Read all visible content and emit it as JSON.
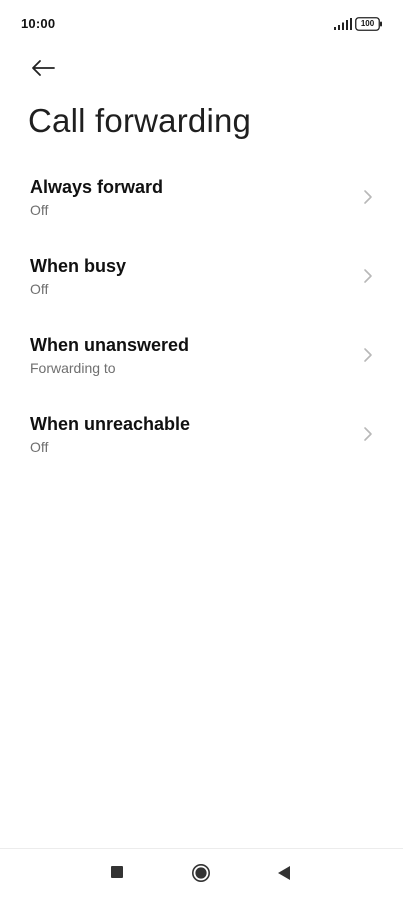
{
  "status_bar": {
    "time": "10:00",
    "battery": "100",
    "signal_icon": "signal-bars-icon",
    "battery_icon": "battery-icon"
  },
  "header": {
    "back_icon": "arrow-left-icon",
    "title": "Call forwarding"
  },
  "options": [
    {
      "title": "Always forward",
      "subtitle": "Off"
    },
    {
      "title": "When busy",
      "subtitle": "Off"
    },
    {
      "title": "When unanswered",
      "subtitle": "Forwarding to"
    },
    {
      "title": "When unreachable",
      "subtitle": "Off"
    }
  ],
  "chevron_icon": "chevron-right-icon",
  "nav_bar": {
    "recents_icon": "square-icon",
    "home_icon": "circle-icon",
    "back_icon": "triangle-left-icon"
  }
}
